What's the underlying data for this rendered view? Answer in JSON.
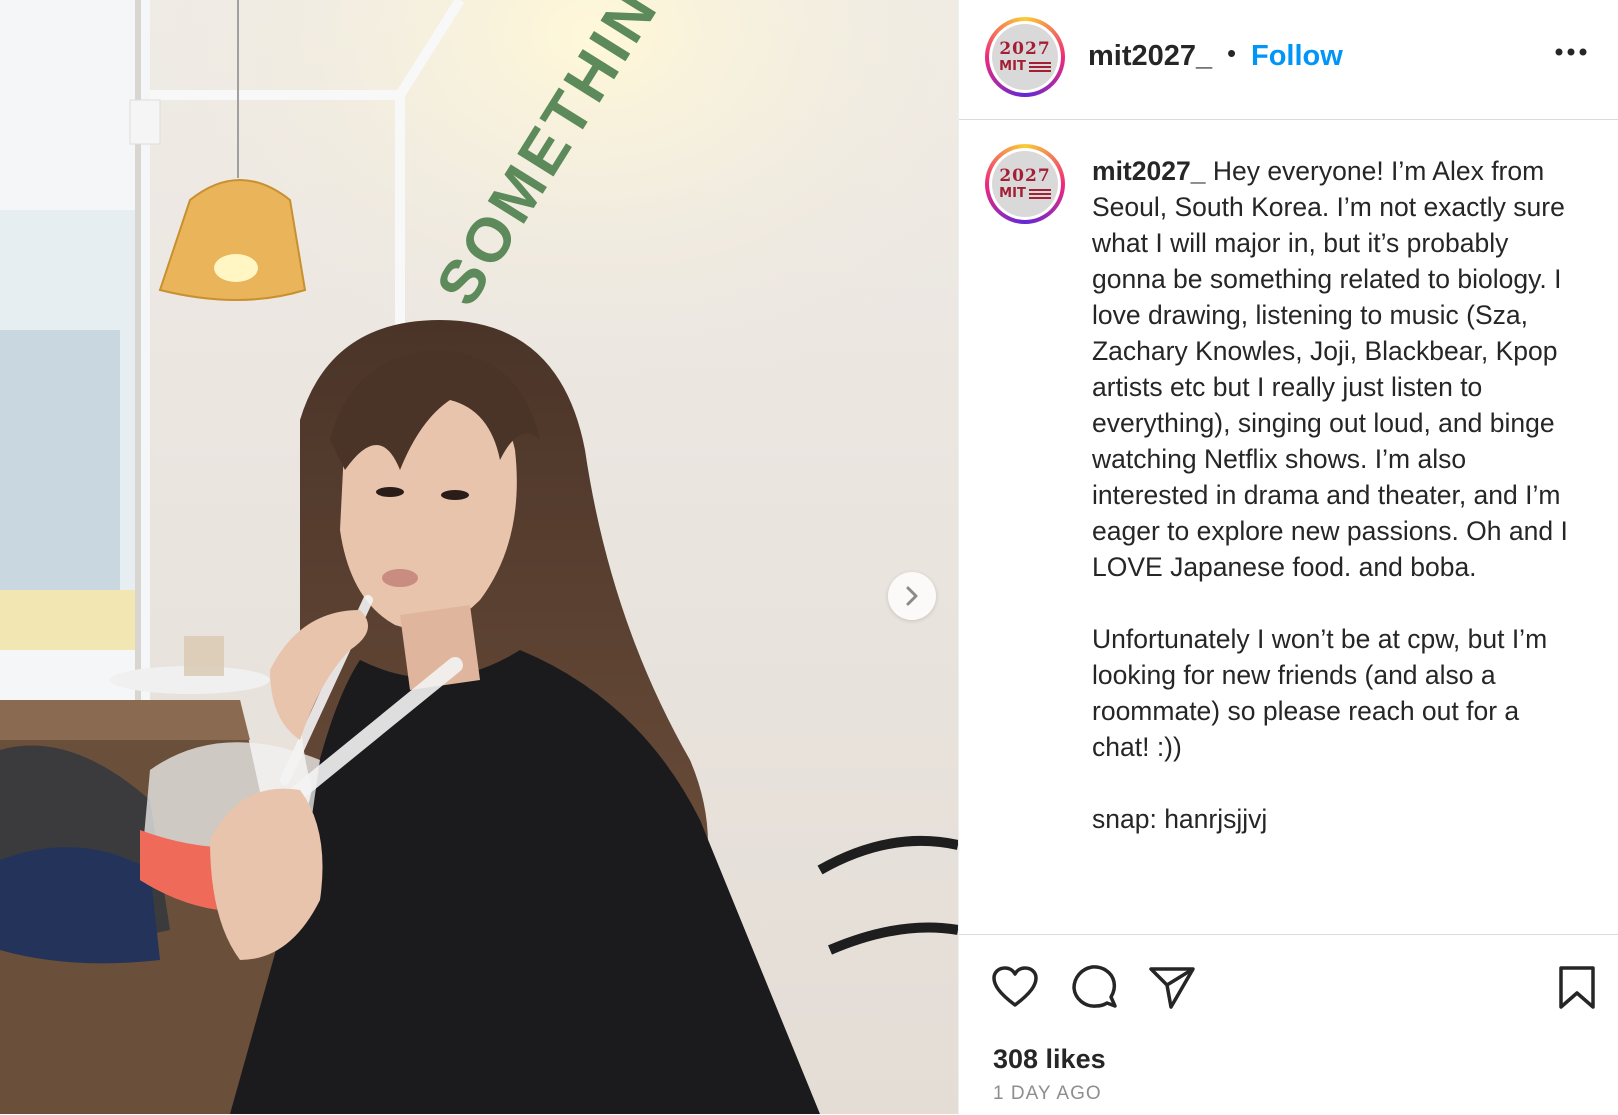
{
  "post": {
    "username": "mit2027_",
    "separator": "•",
    "follow_label": "Follow",
    "avatar": {
      "year": "2027",
      "logo": "MIT"
    },
    "caption": {
      "username": "mit2027_",
      "paragraph1": "Hey everyone! I’m Alex from Seoul, South Korea. I’m not exactly sure what I will major in, but it’s probably gonna be something related to biology. I love drawing, listening to music (Sza, Zachary Knowles, Joji, Blackbear, Kpop artists etc but I really just listen to everything), singing out loud, and binge watching Netflix shows. I’m also interested in drama and theater, and I’m eager to explore new passions. Oh and I LOVE Japanese food. and boba.",
      "paragraph2": "Unfortunately I won’t be at cpw, but I’m looking for new friends (and also a roommate) so please reach out for a chat! :))",
      "paragraph3": "snap: hanrjsjjvj"
    },
    "likes": "308 likes",
    "time_ago": "1 DAY AGO",
    "photo_wall_text": "SOMETHING ABOUT"
  },
  "icons": {
    "more": "more-options-icon",
    "like": "heart-icon",
    "comment": "comment-icon",
    "share": "send-icon",
    "save": "bookmark-icon",
    "next": "chevron-right-icon"
  },
  "colors": {
    "follow_blue": "#0095f6",
    "mit_red": "#a31f34",
    "text": "#262626",
    "muted": "#8e8e8e"
  }
}
